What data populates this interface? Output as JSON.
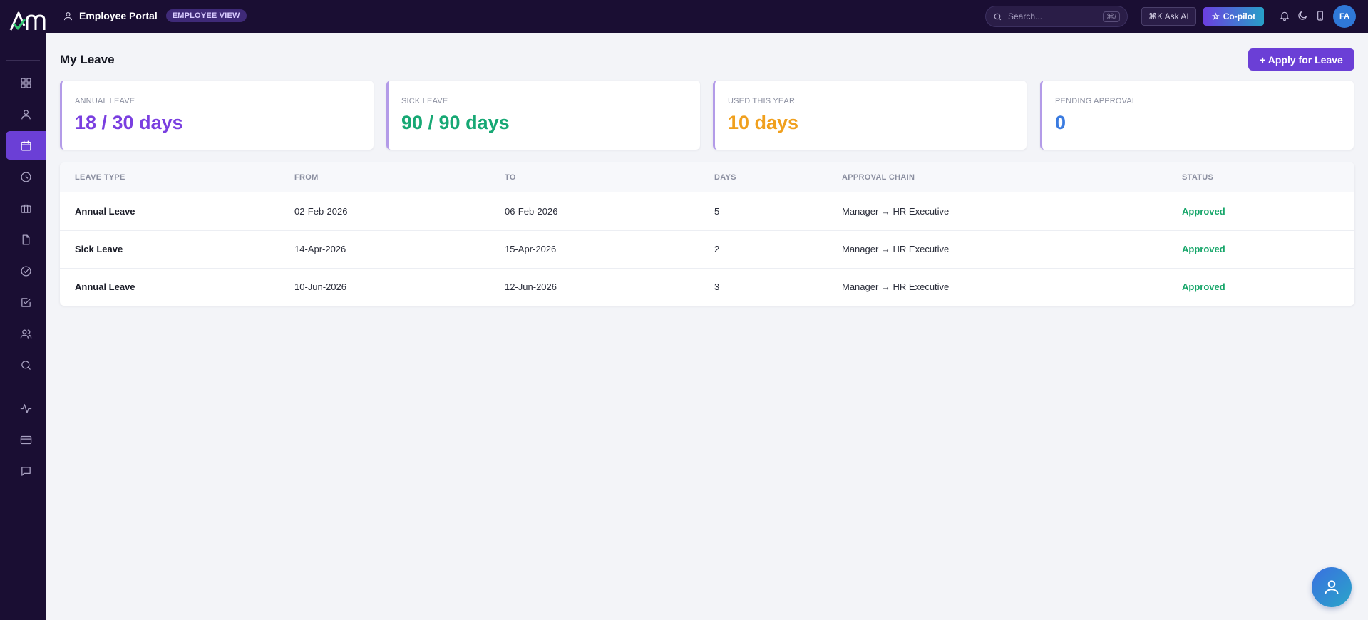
{
  "header": {
    "portal_title": "Employee Portal",
    "view_badge": "EMPLOYEE VIEW",
    "search_placeholder": "Search...",
    "search_shortcut": "⌘/",
    "ask_ai_label": "⌘K Ask AI",
    "copilot_label": "Co-pilot",
    "avatar_initials": "FA"
  },
  "sidebar": {
    "items": [
      {
        "icon": "grid-icon",
        "active": false
      },
      {
        "icon": "user-icon",
        "active": false
      },
      {
        "icon": "calendar-icon",
        "active": true
      },
      {
        "icon": "clock-icon",
        "active": false
      },
      {
        "icon": "briefcase-icon",
        "active": false
      },
      {
        "icon": "document-icon",
        "active": false
      },
      {
        "icon": "check-circle-icon",
        "active": false
      },
      {
        "icon": "check-square-icon",
        "active": false
      },
      {
        "icon": "users-icon",
        "active": false
      },
      {
        "icon": "search-icon",
        "active": false
      },
      {
        "icon": "activity-icon",
        "active": false
      },
      {
        "icon": "credit-card-icon",
        "active": false
      },
      {
        "icon": "message-icon",
        "active": false
      }
    ]
  },
  "main": {
    "title": "My Leave",
    "apply_button": "+ Apply for Leave",
    "cards": [
      {
        "label": "ANNUAL LEAVE",
        "value": "18 / 30 days",
        "color": "#7a3fe0"
      },
      {
        "label": "SICK LEAVE",
        "value": "90 / 90 days",
        "color": "#17a874"
      },
      {
        "label": "USED THIS YEAR",
        "value": "10 days",
        "color": "#f0a01e"
      },
      {
        "label": "PENDING APPROVAL",
        "value": "0",
        "color": "#3a7be0"
      }
    ],
    "table": {
      "headers": [
        "LEAVE TYPE",
        "FROM",
        "TO",
        "DAYS",
        "APPROVAL CHAIN",
        "STATUS"
      ],
      "rows": [
        [
          "Annual Leave",
          "02-Feb-2026",
          "06-Feb-2026",
          "5",
          "Manager → HR Executive",
          "Approved"
        ],
        [
          "Sick Leave",
          "14-Apr-2026",
          "15-Apr-2026",
          "2",
          "Manager → HR Executive",
          "Approved"
        ],
        [
          "Annual Leave",
          "10-Jun-2026",
          "12-Jun-2026",
          "3",
          "Manager → HR Executive",
          "Approved"
        ]
      ]
    }
  },
  "colors": {
    "sidebar_bg": "#1a0e33",
    "accent": "#6b3fd6",
    "approved": "#17a66a"
  }
}
